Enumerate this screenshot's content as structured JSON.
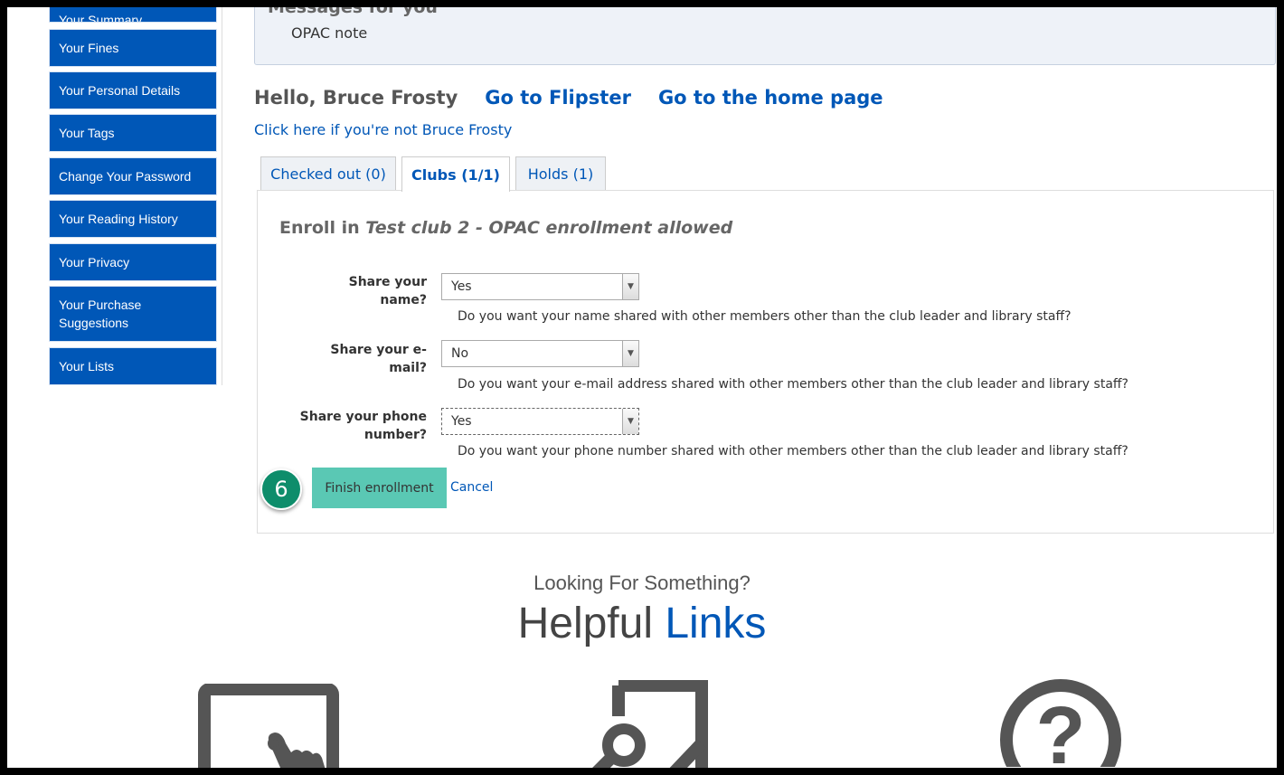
{
  "sidebar": {
    "items": [
      {
        "label": "Your Summary"
      },
      {
        "label": "Your Fines"
      },
      {
        "label": "Your Personal Details"
      },
      {
        "label": "Your Tags"
      },
      {
        "label": "Change Your Password"
      },
      {
        "label": "Your Reading History"
      },
      {
        "label": "Your Privacy"
      },
      {
        "label": "Your Purchase Suggestions"
      },
      {
        "label": "Your Lists"
      }
    ]
  },
  "messages": {
    "heading": "Messages for you",
    "note": "OPAC note"
  },
  "header": {
    "greeting": "Hello, Bruce Frosty",
    "flipster_link": "Go to Flipster",
    "home_link": "Go to the home page",
    "not_you_link": "Click here if you're not Bruce Frosty"
  },
  "tabs": [
    {
      "label": "Checked out (0)",
      "active": false
    },
    {
      "label": "Clubs (1/1)",
      "active": true
    },
    {
      "label": "Holds (1)",
      "active": false
    }
  ],
  "enroll": {
    "prefix": "Enroll in",
    "club_name": "Test club 2 - OPAC enrollment allowed",
    "fields": [
      {
        "label": "Share your name?",
        "value": "Yes",
        "hint": "Do you want your name shared with other members other than the club leader and library staff?"
      },
      {
        "label": "Share your e-mail?",
        "value": "No",
        "hint": "Do you want your e-mail address shared with other members other than the club leader and library staff?"
      },
      {
        "label": "Share your phone number?",
        "value": "Yes",
        "hint": "Do you want your phone number shared with other members other than the club leader and library staff?"
      }
    ],
    "finish_label": "Finish enrollment",
    "cancel_label": "Cancel"
  },
  "step_badge": "6",
  "helpful": {
    "subtitle": "Looking For Something?",
    "title_part1": "Helpful",
    "title_part2": "Links",
    "icons": [
      "touch-screen-icon",
      "search-document-icon",
      "question-icon"
    ]
  },
  "colors": {
    "primary": "#0057b7",
    "finish_button": "#5ac8b4",
    "badge": "#0e8d6b"
  }
}
